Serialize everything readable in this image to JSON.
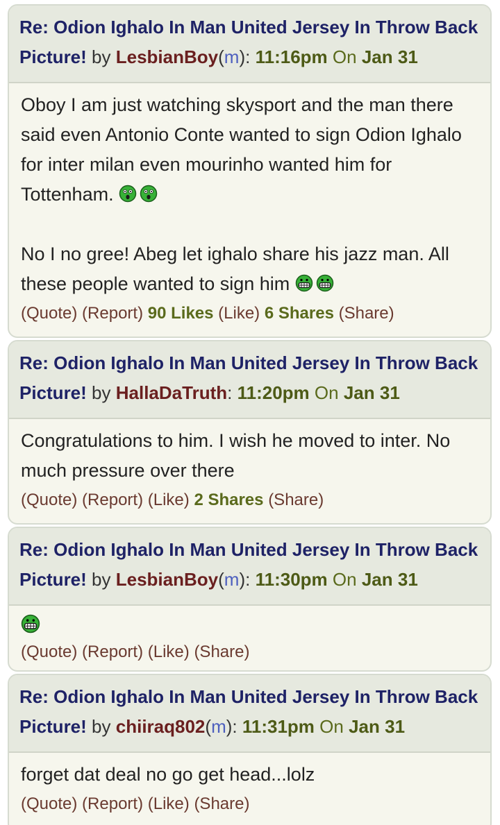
{
  "posts": [
    {
      "title": "Re: Odion Ighalo In Man United Jersey In Throw Back Picture!",
      "by": "by",
      "user": "LesbianBoy",
      "gender": "m",
      "time": "11:16pm",
      "on": "On",
      "date": "Jan 31",
      "body": [
        "Oboy I am just watching skysport and the man there said even Antonio Conte wanted to sign Odion Ighalo for inter milan even mourinho wanted him for Tottenham.",
        "No I no gree! Abeg let ighalo share his jazz man. All these people wanted to sign him"
      ],
      "actions": {
        "quote": "(Quote)",
        "report": "(Report)",
        "likes": "90 Likes",
        "like": "(Like)",
        "shares": "6 Shares",
        "share": "(Share)"
      }
    },
    {
      "title": "Re: Odion Ighalo In Man United Jersey In Throw Back Picture!",
      "by": "by",
      "user": "HallaDaTruth",
      "time": "11:20pm",
      "on": "On",
      "date": "Jan 31",
      "body": [
        "Congratulations to him. I wish he moved to inter. No much pressure over there"
      ],
      "actions": {
        "quote": "(Quote)",
        "report": "(Report)",
        "like": "(Like)",
        "shares": "2 Shares",
        "share": "(Share)"
      }
    },
    {
      "title": "Re: Odion Ighalo In Man United Jersey In Throw Back Picture!",
      "by": "by",
      "user": "LesbianBoy",
      "gender": "m",
      "time": "11:30pm",
      "on": "On",
      "date": "Jan 31",
      "body": [],
      "actions": {
        "quote": "(Quote)",
        "report": "(Report)",
        "like": "(Like)",
        "share": "(Share)"
      }
    },
    {
      "title": "Re: Odion Ighalo In Man United Jersey In Throw Back Picture!",
      "by": "by",
      "user": "chiiraq802",
      "gender": "m",
      "time": "11:31pm",
      "on": "On",
      "date": "Jan 31",
      "body": [
        "forget dat deal no go get head...lolz"
      ],
      "actions": {
        "quote": "(Quote)",
        "report": "(Report)",
        "like": "(Like)",
        "share": "(Share)"
      }
    }
  ],
  "emoticons": {
    "shocked": "shocked-emoticon-icon",
    "grin": "grin-emoticon-icon"
  },
  "colors": {
    "title": "#1e2266",
    "username": "#6a1f1f",
    "gender": "#4d5fbe",
    "time": "#4d5a16",
    "emoticon_face": "#2ea82e"
  }
}
